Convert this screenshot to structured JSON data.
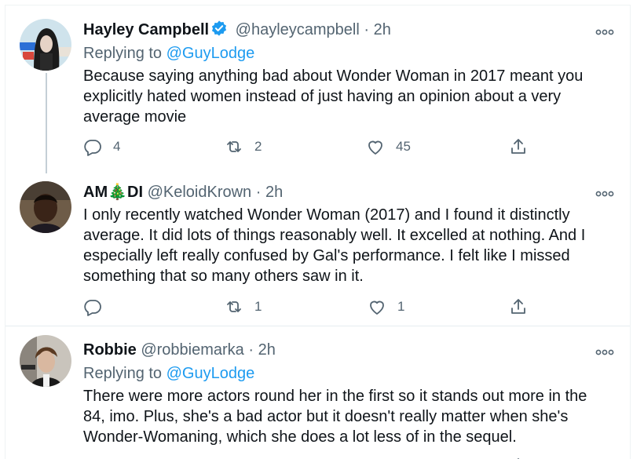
{
  "tweets": [
    {
      "name": "Hayley Campbell",
      "verified": true,
      "handle": "@hayleycampbell",
      "sep": "·",
      "time": "2h",
      "replying_prefix": "Replying to",
      "replying_to": "@GuyLodge",
      "text": "Because saying anything bad about Wonder Woman in 2017 meant you explicitly hated women instead of just having an opinion about a very average movie",
      "replies": "4",
      "retweets": "2",
      "likes": "45"
    },
    {
      "name": "AM🎄DI",
      "verified": false,
      "handle": "@KeloidKrown",
      "sep": "·",
      "time": "2h",
      "text": "I only recently watched Wonder Woman (2017) and I found it distinctly average. It did lots of things reasonably well. It excelled at nothing. And I especially left really confused by Gal's performance. I felt like I missed something that so many others saw in it.",
      "replies": "",
      "retweets": "1",
      "likes": "1"
    },
    {
      "name": "Robbie",
      "verified": false,
      "handle": "@robbiemarka",
      "sep": "·",
      "time": "2h",
      "replying_prefix": "Replying to",
      "replying_to": "@GuyLodge",
      "text": "There were more actors round her in the first so it stands out more in the 84, imo. Plus, she's a bad actor but it doesn't really matter when she's Wonder-Womaning, which she does a lot less of in the sequel."
    }
  ],
  "colors": {
    "accent": "#1d9bf0",
    "secondary": "#536471",
    "text": "#0f1419"
  }
}
